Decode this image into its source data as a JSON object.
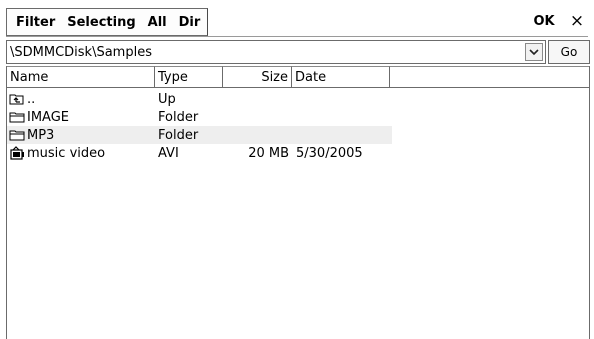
{
  "menu": {
    "items": [
      {
        "label": "Filter"
      },
      {
        "label": "Selecting"
      },
      {
        "label": "All"
      },
      {
        "label": "Dir"
      }
    ]
  },
  "title_buttons": {
    "ok_label": "OK",
    "close_label": "×"
  },
  "path": {
    "value": "\\SDMMCDisk\\Samples",
    "go_label": "Go"
  },
  "list": {
    "columns": [
      "Name",
      "Type",
      "Size",
      "Date"
    ],
    "rows": [
      {
        "icon": "up-folder-icon",
        "name": "..",
        "type": "Up",
        "size": "",
        "date": ""
      },
      {
        "icon": "folder-icon",
        "name": "IMAGE",
        "type": "Folder",
        "size": "",
        "date": ""
      },
      {
        "icon": "folder-icon",
        "name": "MP3",
        "type": "Folder",
        "size": "",
        "date": "",
        "selected": true
      },
      {
        "icon": "video-file-icon",
        "name": "music video",
        "type": "AVI",
        "size": "20 MB",
        "date": "5/30/2005"
      }
    ]
  }
}
